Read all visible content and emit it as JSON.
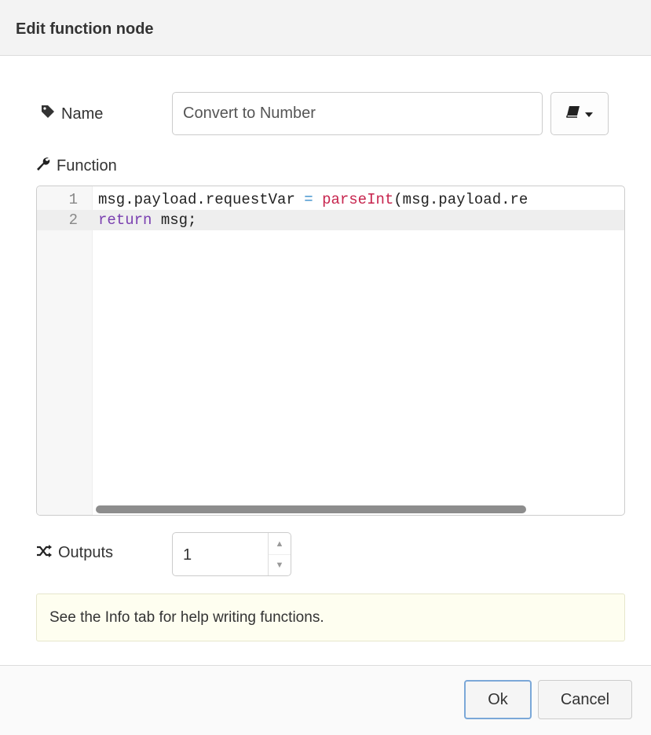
{
  "dialog": {
    "title": "Edit function node"
  },
  "name_field": {
    "label": "Name",
    "value": "Convert to Number",
    "label_icon": "tag-icon",
    "library_icon": "book-icon"
  },
  "function_field": {
    "label": "Function",
    "label_icon": "wrench-icon",
    "lines": [
      {
        "number": "1",
        "tokens": [
          {
            "text": "msg.payload.requestVar ",
            "type": "plain"
          },
          {
            "text": "=",
            "type": "op"
          },
          {
            "text": " ",
            "type": "plain"
          },
          {
            "text": "parseInt",
            "type": "fn"
          },
          {
            "text": "(msg.payload.re",
            "type": "plain"
          }
        ]
      },
      {
        "number": "2",
        "tokens": [
          {
            "text": "return",
            "type": "kw"
          },
          {
            "text": " msg;",
            "type": "plain"
          }
        ]
      }
    ]
  },
  "outputs_field": {
    "label": "Outputs",
    "label_icon": "shuffle-icon",
    "value": "1"
  },
  "tip": {
    "text": "See the Info tab for help writing functions."
  },
  "buttons": {
    "ok": "Ok",
    "cancel": "Cancel"
  }
}
